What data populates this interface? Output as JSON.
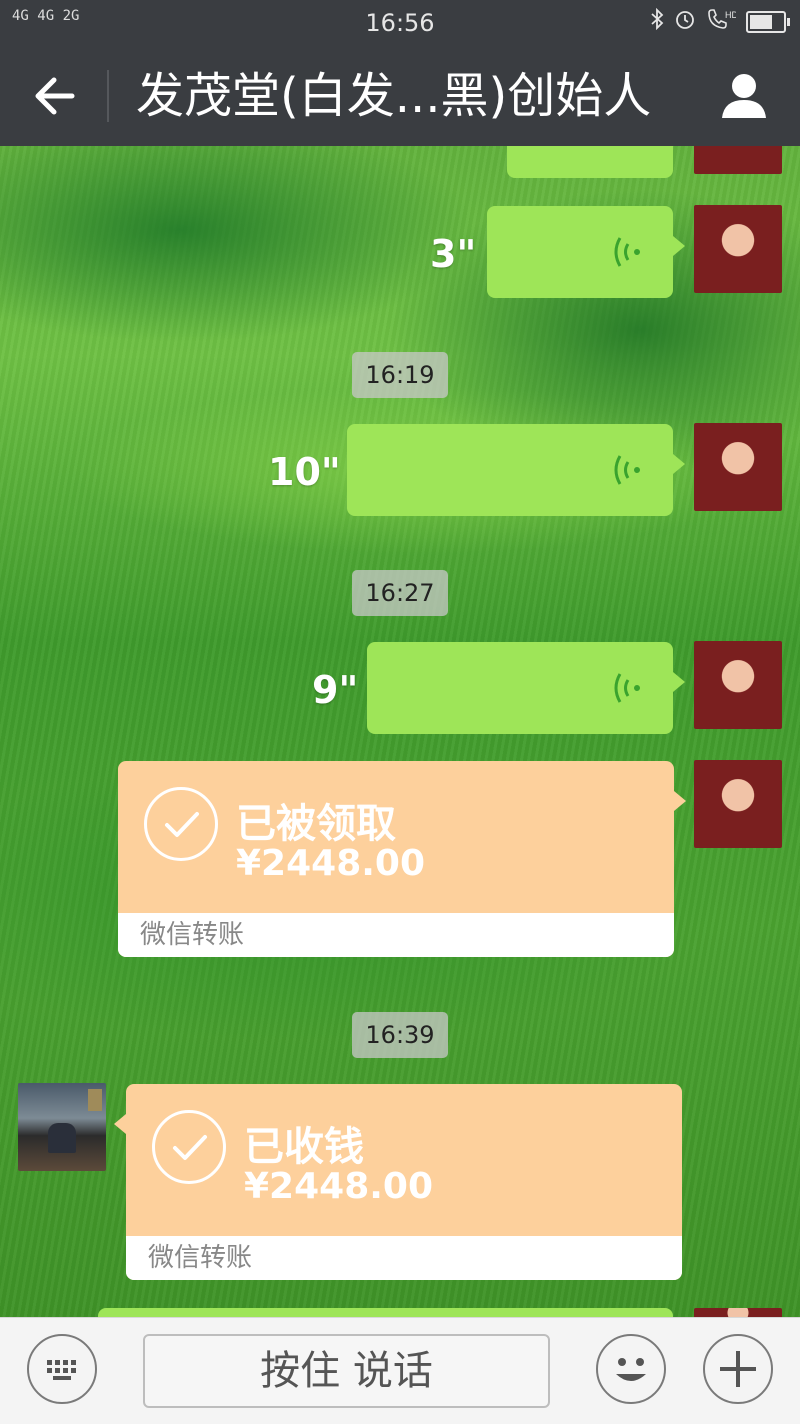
{
  "status_bar": {
    "network": "4G 4G  2G",
    "time": "16:56",
    "icons": [
      "bluetooth-icon",
      "alarm-icon",
      "hd-call-icon",
      "battery-icon"
    ]
  },
  "header": {
    "title": "发茂堂(白发...黑)创始人",
    "back_icon": "back-arrow-icon",
    "profile_icon": "person-icon"
  },
  "chat": {
    "messages": [
      {
        "type": "voice",
        "side": "right",
        "duration": "3\""
      },
      {
        "type": "timestamp",
        "text": "16:19"
      },
      {
        "type": "voice",
        "side": "right",
        "duration": "10\""
      },
      {
        "type": "timestamp",
        "text": "16:27"
      },
      {
        "type": "voice",
        "side": "right",
        "duration": "9\""
      },
      {
        "type": "transfer",
        "side": "right",
        "status": "已被领取",
        "amount": "¥2448.00",
        "footer": "微信转账"
      },
      {
        "type": "timestamp",
        "text": "16:39"
      },
      {
        "type": "transfer",
        "side": "left",
        "status": "已收钱",
        "amount": "¥2448.00",
        "footer": "微信转账"
      }
    ]
  },
  "input_bar": {
    "keyboard_icon": "keyboard-icon",
    "hold_to_talk": "按住 说话",
    "emoji_icon": "emoji-icon",
    "plus_icon": "plus-icon"
  },
  "colors": {
    "bar_bg": "#3a3d41",
    "voice_bubble": "#9ee558",
    "transfer_bubble": "#fdd09c",
    "voice_wave": "#3aa32e"
  }
}
